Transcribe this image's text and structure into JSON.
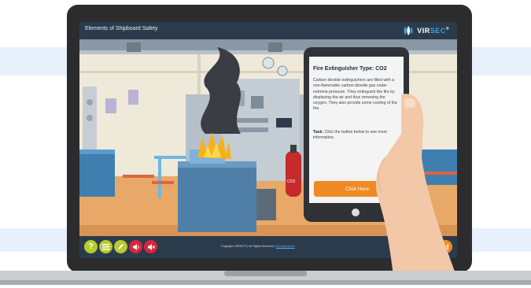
{
  "header": {
    "course_title": "Elements of Shipboard Safety",
    "logo_text_a": "VIR",
    "logo_text_b": "SEC",
    "logo_reg": "®"
  },
  "card": {
    "title": "Fire Extinguisher Type: CO2",
    "body": "Carbon dioxide extinguishers are filled with a non-flammable carbon dioxide gas under extreme pressure. They extinguish the fire by displacing the air and thus removing the oxygen. They also provide some cooling of the fire.",
    "task_label": "Task:",
    "task_text": " Click the button below to see more information.",
    "button_label": "Click Here"
  },
  "scene": {
    "extinguisher_label": "CO2"
  },
  "footer": {
    "copyright": "Copyright VIRSEC® | All Rights Reserved | ",
    "privacy_link": "Security Notice",
    "controls": [
      {
        "name": "help",
        "glyph": "?",
        "color": "#b5cc2e"
      },
      {
        "name": "menu",
        "glyph": "☰",
        "color": "#b5cc2e"
      },
      {
        "name": "notes",
        "glyph": "✎",
        "color": "#b5cc2e"
      },
      {
        "name": "audio",
        "glyph": "◀",
        "color": "#d9263a"
      },
      {
        "name": "mute",
        "glyph": "◀",
        "color": "#d9263a"
      }
    ],
    "nav_prev_color": "#27a8e0",
    "nav_next_color": "#f08a24"
  }
}
